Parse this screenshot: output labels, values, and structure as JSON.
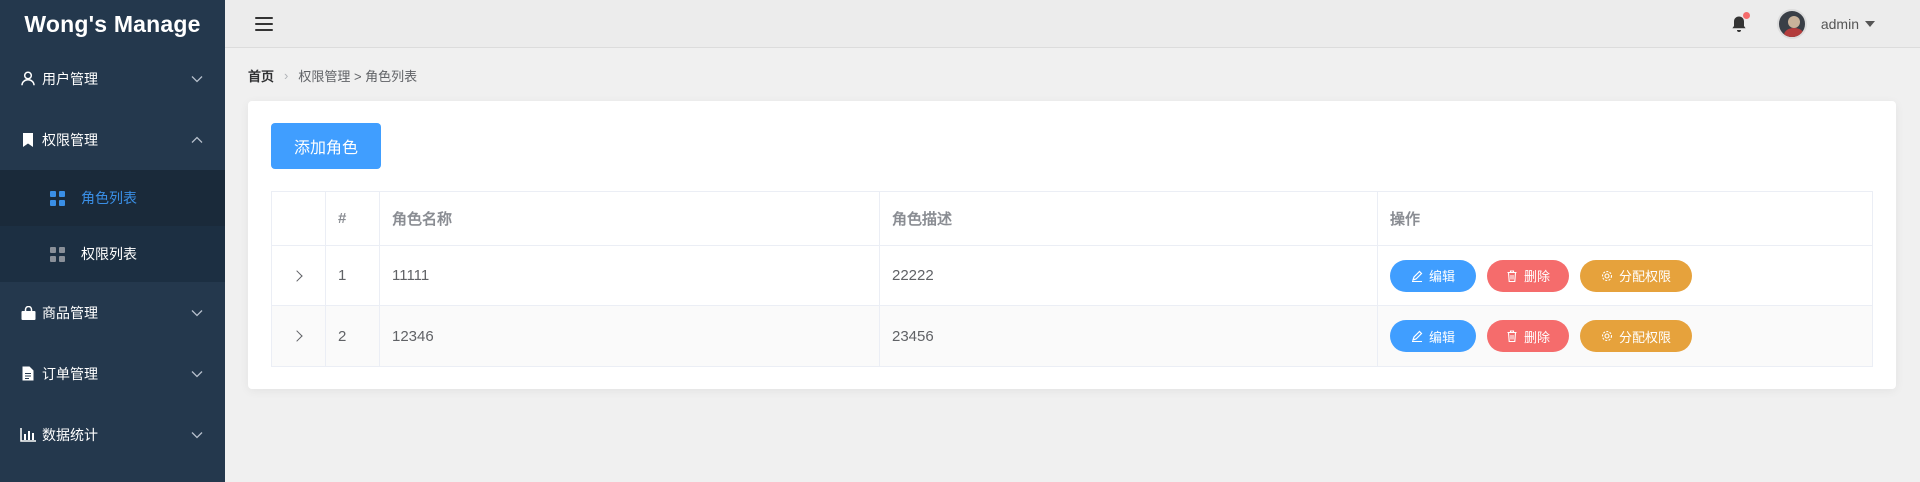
{
  "sidebar": {
    "logo": "Wong's Manage",
    "menus": [
      {
        "label": "用户管理",
        "icon": "user-icon",
        "expanded": false
      },
      {
        "label": "权限管理",
        "icon": "bookmark-icon",
        "expanded": true,
        "children": [
          {
            "label": "角色列表",
            "active": true
          },
          {
            "label": "权限列表",
            "active": false
          }
        ]
      },
      {
        "label": "商品管理",
        "icon": "shopping-bag-icon",
        "expanded": false
      },
      {
        "label": "订单管理",
        "icon": "document-icon",
        "expanded": false
      },
      {
        "label": "数据统计",
        "icon": "bar-chart-icon",
        "expanded": false
      }
    ]
  },
  "header": {
    "user": "admin",
    "notification_dot": true
  },
  "breadcrumb": {
    "home": "首页",
    "path": "权限管理 > 角色列表"
  },
  "main": {
    "add_button": "添加角色",
    "table": {
      "columns": [
        "",
        "#",
        "角色名称",
        "角色描述",
        "操作"
      ],
      "rows": [
        {
          "index": "1",
          "name": "11111",
          "desc": "22222"
        },
        {
          "index": "2",
          "name": "12346",
          "desc": "23456"
        }
      ],
      "actions": {
        "edit": "编辑",
        "delete": "删除",
        "assign": "分配权限"
      }
    }
  },
  "colors": {
    "sidebar_bg": "#24384d",
    "primary": "#409eff",
    "danger": "#f56c6c",
    "warning": "#e6a23c"
  }
}
